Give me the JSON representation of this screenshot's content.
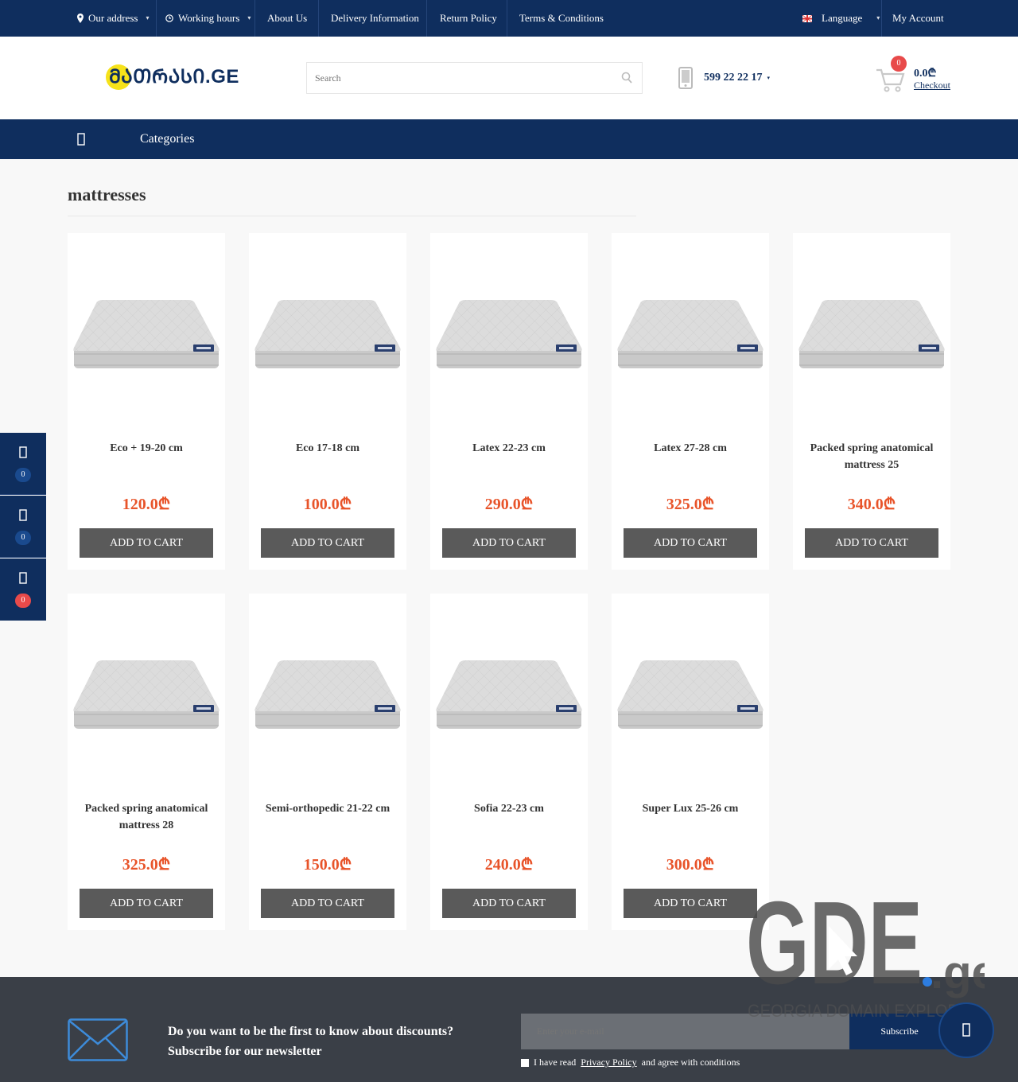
{
  "topbar": {
    "address": "Our address",
    "hours": "Working hours",
    "about": "About Us",
    "delivery": "Delivery Information",
    "returns": "Return Policy",
    "terms": "Terms & Conditions",
    "language": "Language",
    "account": "My Account"
  },
  "header": {
    "logo_text": "ᲛᲐᲗᲠᲐᲡᲘ.GE",
    "search_placeholder": "Search",
    "phone": "599 22 22 17",
    "cart_count": "0",
    "cart_total": "0.0₾",
    "checkout": "Checkout"
  },
  "nav": {
    "categories": "Categories"
  },
  "page": {
    "title": "mattresses"
  },
  "products": [
    {
      "name": "Eco + 19-20 cm",
      "price": "120.0₾",
      "button": "ADD TO CART"
    },
    {
      "name": "Eco 17-18 cm",
      "price": "100.0₾",
      "button": "ADD TO CART"
    },
    {
      "name": "Latex 22-23 cm",
      "price": "290.0₾",
      "button": "ADD TO CART"
    },
    {
      "name": "Latex 27-28 cm",
      "price": "325.0₾",
      "button": "ADD TO CART"
    },
    {
      "name": "Packed spring anatomical mattress 25",
      "price": "340.0₾",
      "button": "ADD TO CART"
    },
    {
      "name": "Packed spring anatomical mattress 28",
      "price": "325.0₾",
      "button": "ADD TO CART"
    },
    {
      "name": "Semi-orthopedic 21-22 cm",
      "price": "150.0₾",
      "button": "ADD TO CART"
    },
    {
      "name": "Sofia 22-23 cm",
      "price": "240.0₾",
      "button": "ADD TO CART"
    },
    {
      "name": "Super Lux 25-26 cm",
      "price": "300.0₾",
      "button": "ADD TO CART"
    }
  ],
  "sidebar": {
    "badges": [
      "0",
      "0",
      "0"
    ]
  },
  "watermark": {
    "brand": "GDE",
    "tld": ".ge",
    "tagline": "GEORGIA DOMAIN EXPLORER"
  },
  "footer": {
    "newsletter_line1": "Do you want to be the first to know about discounts?",
    "newsletter_line2": "Subscribe for our newsletter",
    "email_placeholder": "Enter your e-mail",
    "subscribe": "Subscribe",
    "agree_pre": "I have read",
    "privacy": "Privacy Policy",
    "agree_post": "and agree with conditions"
  },
  "colors": {
    "primary": "#0f2e5e",
    "price": "#e8542a",
    "button": "#5a5a5a",
    "badge_red": "#e84a4a",
    "footer": "#3a3f47"
  }
}
